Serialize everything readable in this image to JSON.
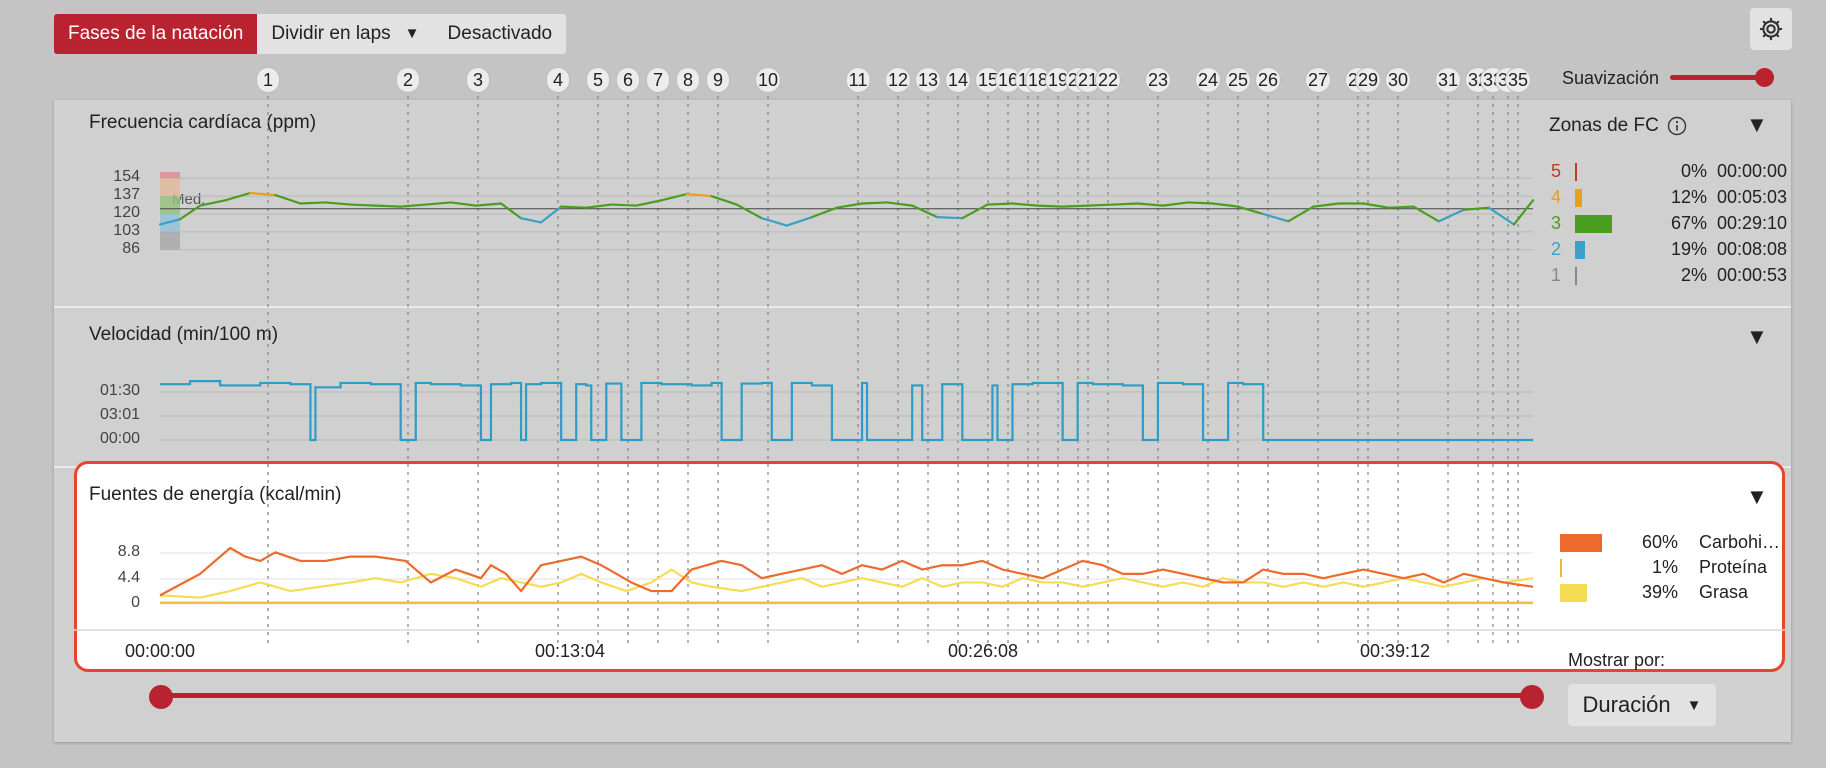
{
  "toolbar": {
    "phases_label": "Fases de la natación",
    "split_label": "Dividir en laps",
    "disabled_label": "Desactivado"
  },
  "smoothing": {
    "label": "Suavización",
    "level": 1.0
  },
  "laps": [
    {
      "label": "1",
      "start": 0.13
    },
    {
      "label": "2",
      "start": 0.27
    },
    {
      "label": "3",
      "start": 0.34
    },
    {
      "label": "4",
      "start": 0.42
    },
    {
      "label": "5",
      "start": 0.46
    },
    {
      "label": "6",
      "start": 0.49
    },
    {
      "label": "7",
      "start": 0.52
    },
    {
      "label": "8",
      "start": 0.55
    },
    {
      "label": "9",
      "start": 0.58
    },
    {
      "label": "10",
      "start": 0.63
    },
    {
      "label": "11",
      "start": 0.72
    },
    {
      "label": "12",
      "start": 0.76
    },
    {
      "label": "13",
      "start": 0.79
    },
    {
      "label": "14",
      "start": 0.82
    },
    {
      "label": "15",
      "start": 0.85
    },
    {
      "label": "16",
      "start": 0.87
    },
    {
      "label": "17",
      "start": 0.89
    },
    {
      "label": "18",
      "start": 0.9
    },
    {
      "label": "19",
      "start": 0.92
    },
    {
      "label": "20",
      "start": 0.94
    },
    {
      "label": "21",
      "start": 0.95
    },
    {
      "label": "22",
      "start": 0.97
    },
    {
      "label": "23",
      "start": 1.02
    },
    {
      "label": "24",
      "start": 1.07
    },
    {
      "label": "25",
      "start": 1.1
    },
    {
      "label": "26",
      "start": 1.13
    },
    {
      "label": "27",
      "start": 1.18
    },
    {
      "label": "28",
      "start": 1.22
    },
    {
      "label": "29",
      "start": 1.23
    },
    {
      "label": "30",
      "start": 1.26
    },
    {
      "label": "31",
      "start": 1.31
    },
    {
      "label": "32",
      "start": 1.34
    },
    {
      "label": "33",
      "start": 1.355
    },
    {
      "label": "34",
      "start": 1.37
    },
    {
      "label": "35",
      "start": 1.38
    }
  ],
  "hr_panel": {
    "title": "Frecuencia cardíaca (ppm)",
    "avg_label": "Med.",
    "zones_title": "Zonas de FC",
    "zones": [
      {
        "zone": "5",
        "percent": "0%",
        "time": "00:00:00",
        "color": "#c0392b",
        "share": 0.0
      },
      {
        "zone": "4",
        "percent": "12%",
        "time": "00:05:03",
        "color": "#e6a019",
        "share": 0.12
      },
      {
        "zone": "3",
        "percent": "67%",
        "time": "00:29:10",
        "color": "#4a9e1f",
        "share": 0.67
      },
      {
        "zone": "2",
        "percent": "19%",
        "time": "00:08:08",
        "color": "#3aa1c8",
        "share": 0.19
      },
      {
        "zone": "1",
        "percent": "2%",
        "time": "00:00:53",
        "color": "#888888",
        "share": 0.02
      }
    ]
  },
  "speed_panel": {
    "title": "Velocidad (min/100 m)"
  },
  "energy_panel": {
    "title": "Fuentes de energía (kcal/min)",
    "sources": [
      {
        "percent": "60%",
        "name": "Carbohi…",
        "color": "#ee6a2c",
        "share": 0.6
      },
      {
        "percent": "1%",
        "name": "Proteína",
        "color": "#f2b53c",
        "share": 0.01
      },
      {
        "percent": "39%",
        "name": "Grasa",
        "color": "#f4dd52",
        "share": 0.39
      }
    ]
  },
  "show_by": {
    "label": "Mostrar por:",
    "value": "Duración"
  },
  "chart_data": [
    {
      "type": "line",
      "title": "Frecuencia cardíaca (ppm)",
      "yticks": [
        "154",
        "137",
        "120",
        "103",
        "86"
      ],
      "ylim": [
        80,
        160
      ],
      "xlim": [
        0,
        2738
      ],
      "avg": 125,
      "series": [
        {
          "x": [
            0,
            40,
            80,
            130,
            180,
            230,
            280,
            330,
            380,
            430,
            480,
            530,
            580,
            630,
            680,
            720,
            760,
            800,
            850,
            900,
            950,
            1000,
            1050,
            1100,
            1150,
            1200,
            1250,
            1300,
            1350,
            1400,
            1450,
            1500,
            1550,
            1600,
            1650,
            1700,
            1750,
            1800,
            1850,
            1900,
            1950,
            2000,
            2050,
            2100,
            2150,
            2200,
            2250,
            2300,
            2350,
            2400,
            2450,
            2500,
            2550,
            2600,
            2650,
            2700,
            2738
          ],
          "y": [
            110,
            115,
            128,
            133,
            140,
            138,
            130,
            131,
            129,
            128,
            127,
            129,
            131,
            128,
            130,
            116,
            112,
            127,
            126,
            129,
            128,
            133,
            139,
            137,
            129,
            116,
            109,
            117,
            126,
            130,
            131,
            128,
            117,
            116,
            129,
            130,
            128,
            127,
            128,
            129,
            130,
            128,
            131,
            130,
            127,
            120,
            113,
            127,
            130,
            130,
            126,
            127,
            113,
            124,
            126,
            110,
            133
          ]
        }
      ]
    },
    {
      "type": "line",
      "title": "Velocidad (min/100 m)",
      "yticks": [
        "01:30",
        "03:01",
        "00:00"
      ],
      "xlim": [
        0,
        2738
      ],
      "series": [
        {
          "x": [
            0,
            60,
            120,
            200,
            260,
            300,
            310,
            360,
            420,
            480,
            500,
            510,
            540,
            600,
            640,
            660,
            700,
            720,
            730,
            760,
            800,
            830,
            850,
            860,
            890,
            920,
            940,
            960,
            1000,
            1060,
            1100,
            1120,
            1130,
            1160,
            1200,
            1220,
            1230,
            1260,
            1300,
            1340,
            1380,
            1400,
            1410,
            1450,
            1500,
            1520,
            1530,
            1560,
            1600,
            1640,
            1660,
            1670,
            1700,
            1740,
            1800,
            1820,
            1830,
            1860,
            1920,
            1960,
            1980,
            1990,
            2040,
            2080,
            2120,
            2130,
            2160,
            2200,
            2250,
            2280,
            2300,
            2310,
            2350,
            2400,
            2430,
            2440,
            2480,
            2520,
            2600,
            2738
          ],
          "y": [
            90,
            95,
            88,
            92,
            90,
            0,
            85,
            92,
            90,
            0,
            0,
            92,
            90,
            88,
            0,
            90,
            92,
            0,
            90,
            92,
            0,
            90,
            88,
            0,
            91,
            0,
            0,
            92,
            90,
            88,
            92,
            0,
            0,
            91,
            92,
            0,
            0,
            92,
            88,
            0,
            0,
            92,
            0,
            0,
            88,
            0,
            0,
            90,
            0,
            0,
            88,
            0,
            90,
            92,
            0,
            0,
            92,
            90,
            88,
            0,
            0,
            92,
            90,
            0,
            0,
            92,
            90,
            0,
            0,
            0,
            0,
            0,
            0,
            0,
            0,
            0,
            0,
            0,
            0,
            0
          ]
        }
      ]
    },
    {
      "type": "line",
      "title": "Fuentes de energía (kcal/min)",
      "yticks": [
        "8.8",
        "4.4",
        "0"
      ],
      "ylim": [
        0,
        13
      ],
      "xlim": [
        0,
        2738
      ],
      "xticks": [
        "00:00:00",
        "00:13:04",
        "00:26:08",
        "00:39:12"
      ],
      "series": [
        {
          "name": "Carbohi…",
          "x": [
            0,
            80,
            140,
            170,
            200,
            230,
            280,
            330,
            380,
            430,
            490,
            540,
            590,
            640,
            660,
            690,
            720,
            760,
            800,
            840,
            880,
            940,
            980,
            1020,
            1060,
            1090,
            1120,
            1160,
            1200,
            1240,
            1280,
            1320,
            1360,
            1400,
            1440,
            1480,
            1520,
            1560,
            1600,
            1640,
            1680,
            1720,
            1760,
            1800,
            1840,
            1880,
            1920,
            1960,
            2000,
            2040,
            2080,
            2120,
            2160,
            2200,
            2240,
            2280,
            2320,
            2360,
            2400,
            2440,
            2480,
            2520,
            2560,
            2600,
            2640,
            2680,
            2738
          ],
          "y": [
            2,
            7,
            13,
            11,
            10,
            12,
            10,
            10,
            11,
            11,
            10,
            5,
            8,
            6,
            9,
            7,
            3,
            9,
            10,
            11,
            9,
            5,
            3,
            3,
            8,
            9,
            10,
            9,
            6,
            7,
            8,
            9,
            7,
            9,
            8,
            10,
            8,
            9,
            9,
            10,
            8,
            7,
            6,
            8,
            10,
            9,
            7,
            7,
            8,
            7,
            6,
            5,
            5,
            8,
            7,
            7,
            6,
            7,
            8,
            7,
            6,
            7,
            5,
            7,
            6,
            5,
            4
          ]
        },
        {
          "name": "Proteína",
          "x": [
            0,
            2738
          ],
          "y": [
            0.3,
            0.3
          ]
        },
        {
          "name": "Grasa",
          "x": [
            0,
            80,
            140,
            200,
            260,
            320,
            380,
            430,
            480,
            540,
            590,
            640,
            680,
            720,
            760,
            800,
            840,
            880,
            930,
            980,
            1020,
            1060,
            1100,
            1160,
            1200,
            1240,
            1280,
            1320,
            1360,
            1400,
            1440,
            1480,
            1520,
            1560,
            1600,
            1640,
            1680,
            1720,
            1760,
            1800,
            1840,
            1880,
            1920,
            1960,
            2000,
            2040,
            2080,
            2120,
            2160,
            2200,
            2240,
            2280,
            2320,
            2360,
            2400,
            2440,
            2480,
            2520,
            2560,
            2600,
            2640,
            2680,
            2738
          ],
          "y": [
            2,
            1.5,
            3,
            5,
            3,
            4,
            5,
            6,
            5,
            7,
            6,
            4,
            6,
            5,
            4,
            5,
            7,
            5,
            3,
            5,
            8,
            5,
            4,
            3,
            4,
            5,
            6,
            4,
            5,
            6,
            5,
            4,
            6,
            4,
            5,
            5,
            4,
            6,
            5,
            5,
            4,
            5,
            6,
            5,
            4,
            5,
            4,
            6,
            5,
            5,
            4,
            5,
            4,
            5,
            4,
            5,
            6,
            5,
            4,
            5,
            6,
            5,
            6
          ]
        }
      ]
    }
  ]
}
